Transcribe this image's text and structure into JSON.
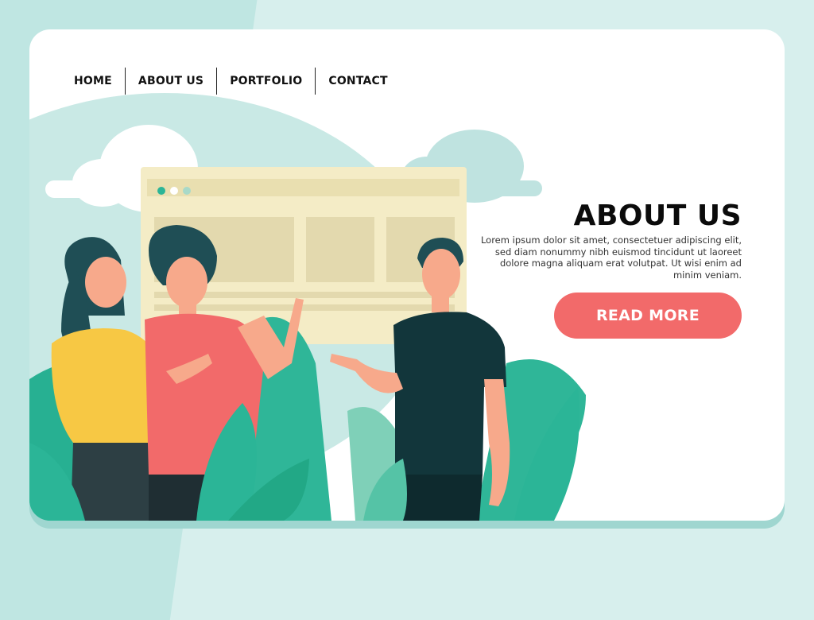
{
  "nav": {
    "items": [
      {
        "label": "HOME"
      },
      {
        "label": "ABOUT US"
      },
      {
        "label": "PORTFOLIO"
      },
      {
        "label": "CONTACT"
      }
    ]
  },
  "hero": {
    "title": "ABOUT US",
    "description": "Lorem ipsum dolor sit amet, consectetuer adipiscing elit, sed diam nonummy nibh euismod tincidunt ut laoreet dolore magna aliquam erat volutpat. Ut wisi enim ad minim veniam.",
    "button_label": "READ MORE"
  },
  "colors": {
    "background": "#bfe6e2",
    "card": "#ffffff",
    "accent_button": "#f26a6a",
    "leaf_green": "#2bb597",
    "dark_teal": "#1f4e55",
    "window_cream": "#f4ecc6"
  }
}
